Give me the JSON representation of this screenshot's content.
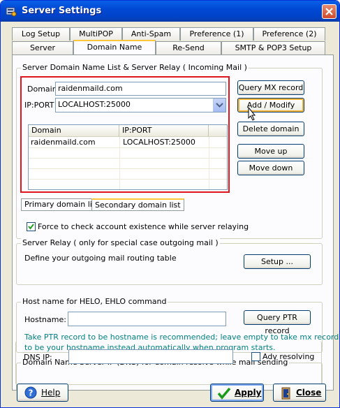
{
  "window": {
    "title": "Server Settings"
  },
  "tabs_row1": [
    "Log Setup",
    "MultiPOP",
    "Anti-Spam",
    "Preference (1)",
    "Preference (2)"
  ],
  "tabs_row2": [
    "Server",
    "Domain Name",
    "Re-Send",
    "SMTP & POP3 Setup"
  ],
  "active_tab": "Domain Name",
  "domain_group": {
    "label": "Server Domain Name List & Server Relay ( Incoming Mail )",
    "domain_label": "Domain",
    "domain_value": "raidenmaild.com",
    "ipport_label": "IP:PORT",
    "ipport_value": "LOCALHOST:25000",
    "list": {
      "columns": [
        "Domain",
        "IP:PORT"
      ],
      "rows": [
        [
          "raidenmaild.com",
          "LOCALHOST:25000"
        ]
      ]
    },
    "buttons": {
      "query_mx": "Query MX record",
      "add_modify": "Add / Modify",
      "delete": "Delete domain",
      "move_up": "Move up",
      "move_down": "Move down"
    },
    "subtabs": [
      "Primary domain list",
      "Secondary domain list"
    ],
    "force_check_label": "Force to check account existence while server relaying",
    "force_check_checked": true
  },
  "relay_group": {
    "label": "Server Relay ( only for special case outgoing mail )",
    "desc": "Define your outgoing mail routing table",
    "setup_button": "Setup ..."
  },
  "hostname_group": {
    "label": "Host name for HELO, EHLO command",
    "hostname_label": "Hostname:",
    "hostname_value": "",
    "query_ptr_button": "Query PTR record",
    "hint_line1": "Take PTR record to be hostname is recommended; leave empty to take mx record",
    "hint_line2": "to be your hostname instead automatically when program starts."
  },
  "dns_group": {
    "label": "Domain Name Server IP (DNS) for domain resolve while mail sending",
    "dns_label": "DNS IP:",
    "dns_value": "",
    "adv_label": "Adv resolving",
    "adv_checked": false
  },
  "footer": {
    "help": "Help",
    "apply": "Apply",
    "close": "Close"
  },
  "colors": {
    "title_bar": "#0049d4",
    "highlight_box": "#e0141c",
    "hint_text": "#008080",
    "focus_ring": "#f8b330"
  }
}
